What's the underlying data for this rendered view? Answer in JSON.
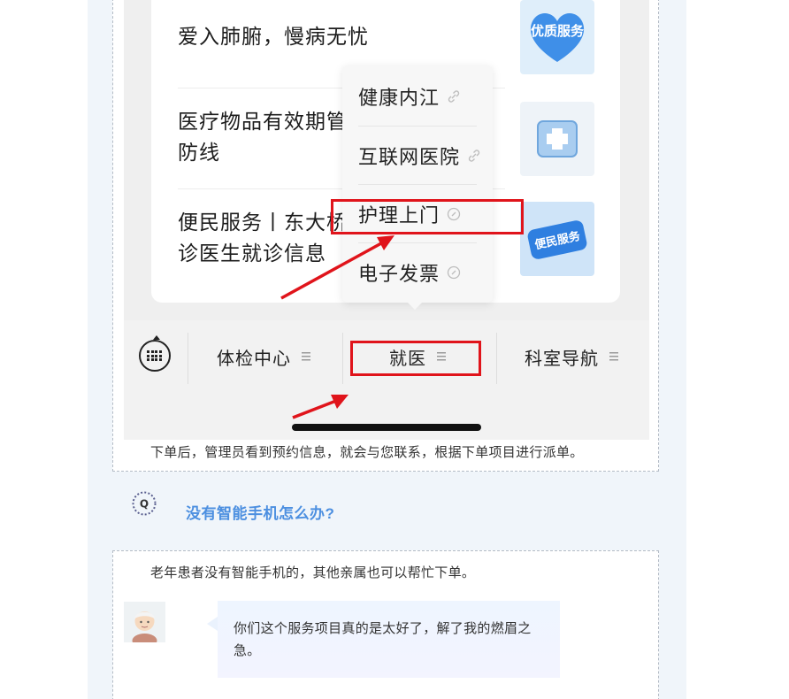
{
  "phone": {
    "news": [
      {
        "title_line1": "爱入肺腑，慢病无忧",
        "title_line2": "",
        "thumb": "优质服务"
      },
      {
        "title_line1": "医疗物品有效期管",
        "title_line2": "防线",
        "thumb": ""
      },
      {
        "title_line1": "便民服务丨东大桥",
        "title_line2": "诊医生就诊信息",
        "thumb": "便民服务"
      }
    ],
    "popup_items": [
      {
        "label": "健康内江"
      },
      {
        "label": "互联网医院"
      },
      {
        "label": "护理上门"
      },
      {
        "label": "电子发票"
      }
    ],
    "menu_tabs": [
      {
        "label": "体检中心"
      },
      {
        "label": "就医"
      },
      {
        "label": "科室导航"
      }
    ]
  },
  "caption": "下单后，管理员看到预约信息，就会与您联系，根据下单项目进行派单。",
  "faq": {
    "question": "没有智能手机怎么办?",
    "answer": "老年患者没有智能手机的，其他亲属也可以帮忙下单。",
    "testimonial": "你们这个服务项目真的是太好了，解了我的燃眉之急。"
  },
  "colors": {
    "highlight_red": "#e0141b",
    "question_blue": "#4c8fe0",
    "article_bg": "#f0f5fa"
  }
}
